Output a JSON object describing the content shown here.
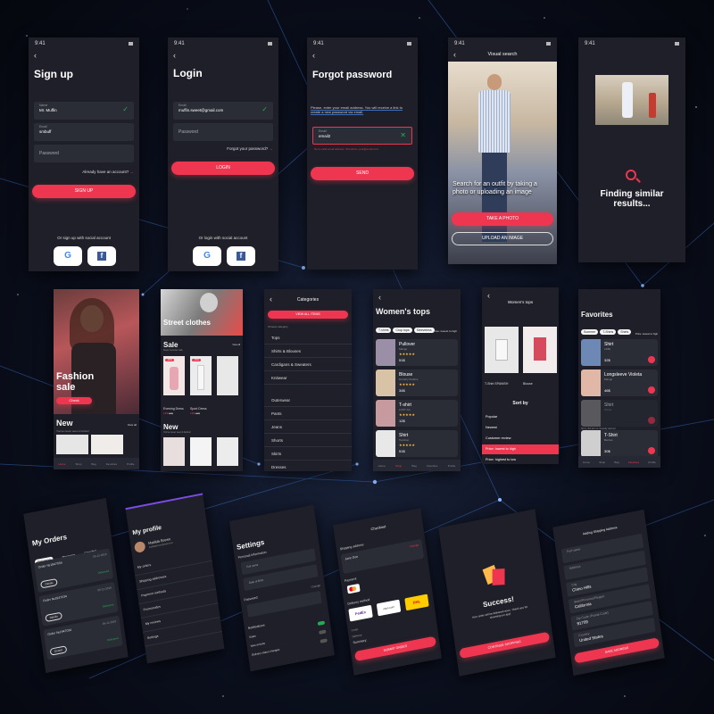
{
  "status_time": "9:41",
  "colors": {
    "accent": "#ef3651",
    "success": "#2aa952",
    "background": "#1e1f28",
    "surface": "#2a2c36"
  },
  "signup": {
    "title": "Sign up",
    "name_label": "Name",
    "name_value": "Mr. Muffin",
    "email_label": "Email",
    "email_value": "smbuff",
    "password_placeholder": "Password",
    "have_account": "Already have an account?",
    "button": "SIGN UP",
    "social_prompt": "Or sign up with social account"
  },
  "login": {
    "title": "Login",
    "email_label": "Email",
    "email_value": "muffin.sweet@gmail.com",
    "password_placeholder": "Password",
    "forgot": "Forgot your password?",
    "button": "LOGIN",
    "social_prompt": "Or login with social account"
  },
  "forgot": {
    "title": "Forgot password",
    "description": "Please, enter your email address. You will receive a link to create a new password via email.",
    "email_label": "Email",
    "email_value": "email2",
    "error": "Not a valid email address. Should be your@email.com",
    "button": "SEND"
  },
  "visual_search": {
    "title": "Visual search",
    "headline": "Search for an outfit by taking a photo or uploading an image",
    "take_photo": "TAKE A PHOTO",
    "upload": "UPLOAD AN IMAGE"
  },
  "finding": {
    "text": "Finding similar results..."
  },
  "fashion": {
    "headline": "Fashion sale",
    "button": "Check",
    "section": "New",
    "sub": "You've never seen it before!",
    "view_all": "View all"
  },
  "street": {
    "banner": "Street clothes",
    "sale": "Sale",
    "sale_sub": "Super summer sale",
    "new": "New",
    "new_sub": "You've never seen it before!",
    "view_all": "View all",
    "products": [
      {
        "name": "Evening Dress",
        "brand": "Dorothy Perkins",
        "price": "15$",
        "old": "12$",
        "badge": "-20%"
      },
      {
        "name": "Sport Dress",
        "brand": "Sitlly",
        "price": "22$",
        "old": "19$",
        "badge": "-15%"
      }
    ]
  },
  "categories": {
    "title": "Categories",
    "button": "VIEW ALL ITEMS",
    "prompt": "Choose category",
    "items": [
      "Tops",
      "Shirts & Blouses",
      "Cardigans & Sweaters",
      "Knitwear",
      "Outerwear",
      "Pants",
      "Jeans",
      "Shorts",
      "Skirts",
      "Dresses"
    ]
  },
  "womens_tops": {
    "title": "Women's tops",
    "chips": [
      "T-shirts",
      "Crop tops",
      "Sleeveless"
    ],
    "sort": "Price: lowest to high",
    "filters": "Filters",
    "products": [
      {
        "name": "Pullover",
        "brand": "Mango",
        "price": "51$"
      },
      {
        "name": "Blouse",
        "brand": "Dorothy Perkins",
        "price": "34$"
      },
      {
        "name": "T-shirt",
        "brand": "LOST Ink",
        "price": "12$"
      },
      {
        "name": "Shirt",
        "brand": "Topshop",
        "price": "51$"
      }
    ]
  },
  "sort_by": {
    "title": "Women's tops",
    "sheet": "Sort by",
    "items": [
      "Popular",
      "Newest",
      "Customer review",
      "Price: lowest to high",
      "Price: highest to low"
    ],
    "selected": "Price: lowest to high",
    "product_a": "T-Shirt SPANISH",
    "price_a": "9$",
    "product_b": "Blouse",
    "price_b": "21$"
  },
  "favorites": {
    "title": "Favorites",
    "chips": [
      "Summer",
      "T-Shirts",
      "Shirts"
    ],
    "sort": "Price: lowest to high",
    "items": [
      {
        "name": "Shirt",
        "brand": "LIME",
        "price": "32$"
      },
      {
        "name": "Longsleeve Violeta",
        "brand": "Mango",
        "price": "46$"
      },
      {
        "name": "Shirt",
        "brand": "Olivier",
        "price": ""
      },
      {
        "name": "T-Shirt",
        "brand": "Berries",
        "price": "30$"
      }
    ],
    "note": "Sorry, this item is currently sold out"
  },
  "orders": {
    "title": "My Orders",
    "tabs": [
      "Delivered",
      "Processing",
      "Cancelled"
    ],
    "items": [
      {
        "no": "Order №1947034",
        "date": "05-12-2019",
        "status": "Delivered",
        "button": "Details"
      },
      {
        "no": "Order №1947034",
        "date": "05-12-2019",
        "status": "Delivered",
        "button": "Details"
      },
      {
        "no": "Order №1947034",
        "date": "05-12-2019",
        "status": "Delivered",
        "button": "Details"
      }
    ]
  },
  "profile": {
    "title": "My profile",
    "name": "Matilda Brown",
    "email": "matildabrown@mail.com",
    "items": [
      "My orders",
      "Shipping addresses",
      "Payment methods",
      "Promocodes",
      "My reviews",
      "Settings"
    ]
  },
  "settings": {
    "title": "Settings",
    "section": "Personal Information",
    "full_name": "Full name",
    "dob": "Date of Birth",
    "password": "Password",
    "change": "Change",
    "notifications": "Notifications",
    "n1": "Sales",
    "n2": "New arrivals",
    "n3": "Delivery status changes"
  },
  "checkout": {
    "title": "Checkout",
    "shipping": "Shipping address",
    "change": "Change",
    "name": "Jane Doe",
    "payment": "Payment",
    "delivery": "Delivery method",
    "carriers": [
      "FedEx",
      "usps.com",
      "DHL"
    ],
    "order": "Order:",
    "delivery_cost": "Delivery:",
    "summary": "Summary:",
    "button": "SUBMIT ORDER"
  },
  "success": {
    "title": "Success!",
    "text": "Your order will be delivered soon. Thank you for choosing our app!",
    "button": "CONTINUE SHOPPING"
  },
  "address": {
    "title": "Adding Shipping Address",
    "fields": [
      "Full name",
      "Address",
      "City",
      "State/Province/Region",
      "Zip Code (Postal Code)",
      "Country"
    ],
    "values": [
      "",
      "",
      "Chino Hills",
      "California",
      "91709",
      "United States"
    ],
    "button": "SAVE ADDRESS"
  },
  "tabbar": [
    "Home",
    "Shop",
    "Bag",
    "Favorites",
    "Profile"
  ]
}
